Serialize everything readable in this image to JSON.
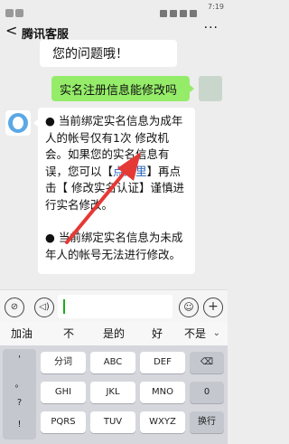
{
  "status_bar": {
    "time": "7:19"
  },
  "header": {
    "back_glyph": "<",
    "title": "腾讯客服",
    "more_glyph": "···"
  },
  "messages": {
    "service_partial": "您的问题哦！",
    "user_question": "实名注册信息能修改吗",
    "service_reply": {
      "p1_before_link": "● 当前绑定实名信息为成年人的帐号仅有1次 修改机会。如果您的实名信息有误，您可以【",
      "link_text": "点这里",
      "p1_after_link": "】再点击【 修改实名认证】谨慎进行实名修改。",
      "p2": "● 当前绑定实名信息为未成年人的帐号无法进行修改。"
    }
  },
  "input_bar": {
    "voice_glyph": "⊘",
    "voice2_glyph": "◁)",
    "emoji_glyph": "☺",
    "plus_glyph": "+"
  },
  "suggestions": [
    "加油",
    "不",
    "是的",
    "好",
    "不是"
  ],
  "keyboard": {
    "side_symbols": [
      "'",
      "。",
      "?",
      "!"
    ],
    "rows": [
      [
        "分词",
        "ABC",
        "DEF"
      ],
      [
        "GHI",
        "JKL",
        "MNO"
      ],
      [
        "PQRS",
        "TUV",
        "WXYZ"
      ]
    ],
    "delete_glyph": "⌫",
    "zero": "0",
    "newline": "换行"
  },
  "colors": {
    "user_bubble": "#95ec69",
    "link": "#1e60b8",
    "arrow": "#e53935"
  }
}
